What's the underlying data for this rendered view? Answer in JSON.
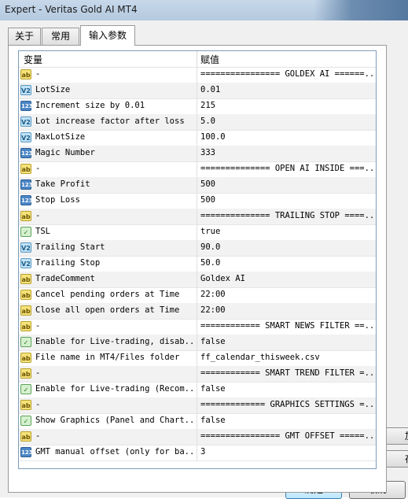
{
  "window": {
    "title": "Expert - Veritas Gold AI MT4"
  },
  "tabs": [
    {
      "label": "关于"
    },
    {
      "label": "常用"
    },
    {
      "label": "输入参数"
    }
  ],
  "grid": {
    "col_variable": "变量",
    "col_value": "赋值",
    "rows": [
      {
        "icon": "ab",
        "icon_text": "ab",
        "name": "-",
        "value": "================ GOLDEX AI ======..."
      },
      {
        "icon": "v2",
        "icon_text": "V2",
        "name": "LotSize",
        "value": "0.01"
      },
      {
        "icon": "n123",
        "icon_text": "123",
        "name": "Increment size by 0.01",
        "value": "215"
      },
      {
        "icon": "v2",
        "icon_text": "V2",
        "name": "Lot increase factor after loss",
        "value": "5.0"
      },
      {
        "icon": "v2",
        "icon_text": "V2",
        "name": "MaxLotSize",
        "value": "100.0"
      },
      {
        "icon": "n123",
        "icon_text": "123",
        "name": "Magic Number",
        "value": "333"
      },
      {
        "icon": "ab",
        "icon_text": "ab",
        "name": "-",
        "value": "============== OPEN AI INSIDE ===..."
      },
      {
        "icon": "n123",
        "icon_text": "123",
        "name": "Take Profit",
        "value": "500"
      },
      {
        "icon": "n123",
        "icon_text": "123",
        "name": "Stop Loss",
        "value": "500"
      },
      {
        "icon": "ab",
        "icon_text": "ab",
        "name": "-",
        "value": "============== TRAILING STOP ====..."
      },
      {
        "icon": "bool",
        "icon_text": "✓",
        "name": "TSL",
        "value": "true"
      },
      {
        "icon": "v2",
        "icon_text": "V2",
        "name": "Trailing Start",
        "value": "90.0"
      },
      {
        "icon": "v2",
        "icon_text": "V2",
        "name": "Trailing Stop",
        "value": "50.0"
      },
      {
        "icon": "ab",
        "icon_text": "ab",
        "name": "TradeComment",
        "value": "Goldex AI"
      },
      {
        "icon": "ab",
        "icon_text": "ab",
        "name": "Cancel pending orders at Time",
        "value": "22:00"
      },
      {
        "icon": "ab",
        "icon_text": "ab",
        "name": "Close all open orders at Time",
        "value": "22:00"
      },
      {
        "icon": "ab",
        "icon_text": "ab",
        "name": "-",
        "value": "============ SMART NEWS FILTER ==..."
      },
      {
        "icon": "bool",
        "icon_text": "✓",
        "name": "Enable for Live-trading, disab...",
        "value": "false"
      },
      {
        "icon": "ab",
        "icon_text": "ab",
        "name": "File name in MT4/Files folder",
        "value": "ff_calendar_thisweek.csv"
      },
      {
        "icon": "ab",
        "icon_text": "ab",
        "name": "-",
        "value": "============ SMART TREND FILTER =..."
      },
      {
        "icon": "bool",
        "icon_text": "✓",
        "name": "Enable for Live-trading (Recom...",
        "value": "false"
      },
      {
        "icon": "ab",
        "icon_text": "ab",
        "name": "-",
        "value": "============= GRAPHICS SETTINGS =..."
      },
      {
        "icon": "bool",
        "icon_text": "✓",
        "name": "Show Graphics (Panel and Chart...",
        "value": "false"
      },
      {
        "icon": "ab",
        "icon_text": "ab",
        "name": "-",
        "value": "================ GMT OFFSET =====..."
      },
      {
        "icon": "n123",
        "icon_text": "123",
        "name": "GMT manual offset (only for ba...",
        "value": "3"
      }
    ]
  },
  "side_buttons": [
    {
      "label": "加"
    },
    {
      "label": "存"
    }
  ],
  "buttons": {
    "ok": "确定",
    "cancel": "取消"
  }
}
